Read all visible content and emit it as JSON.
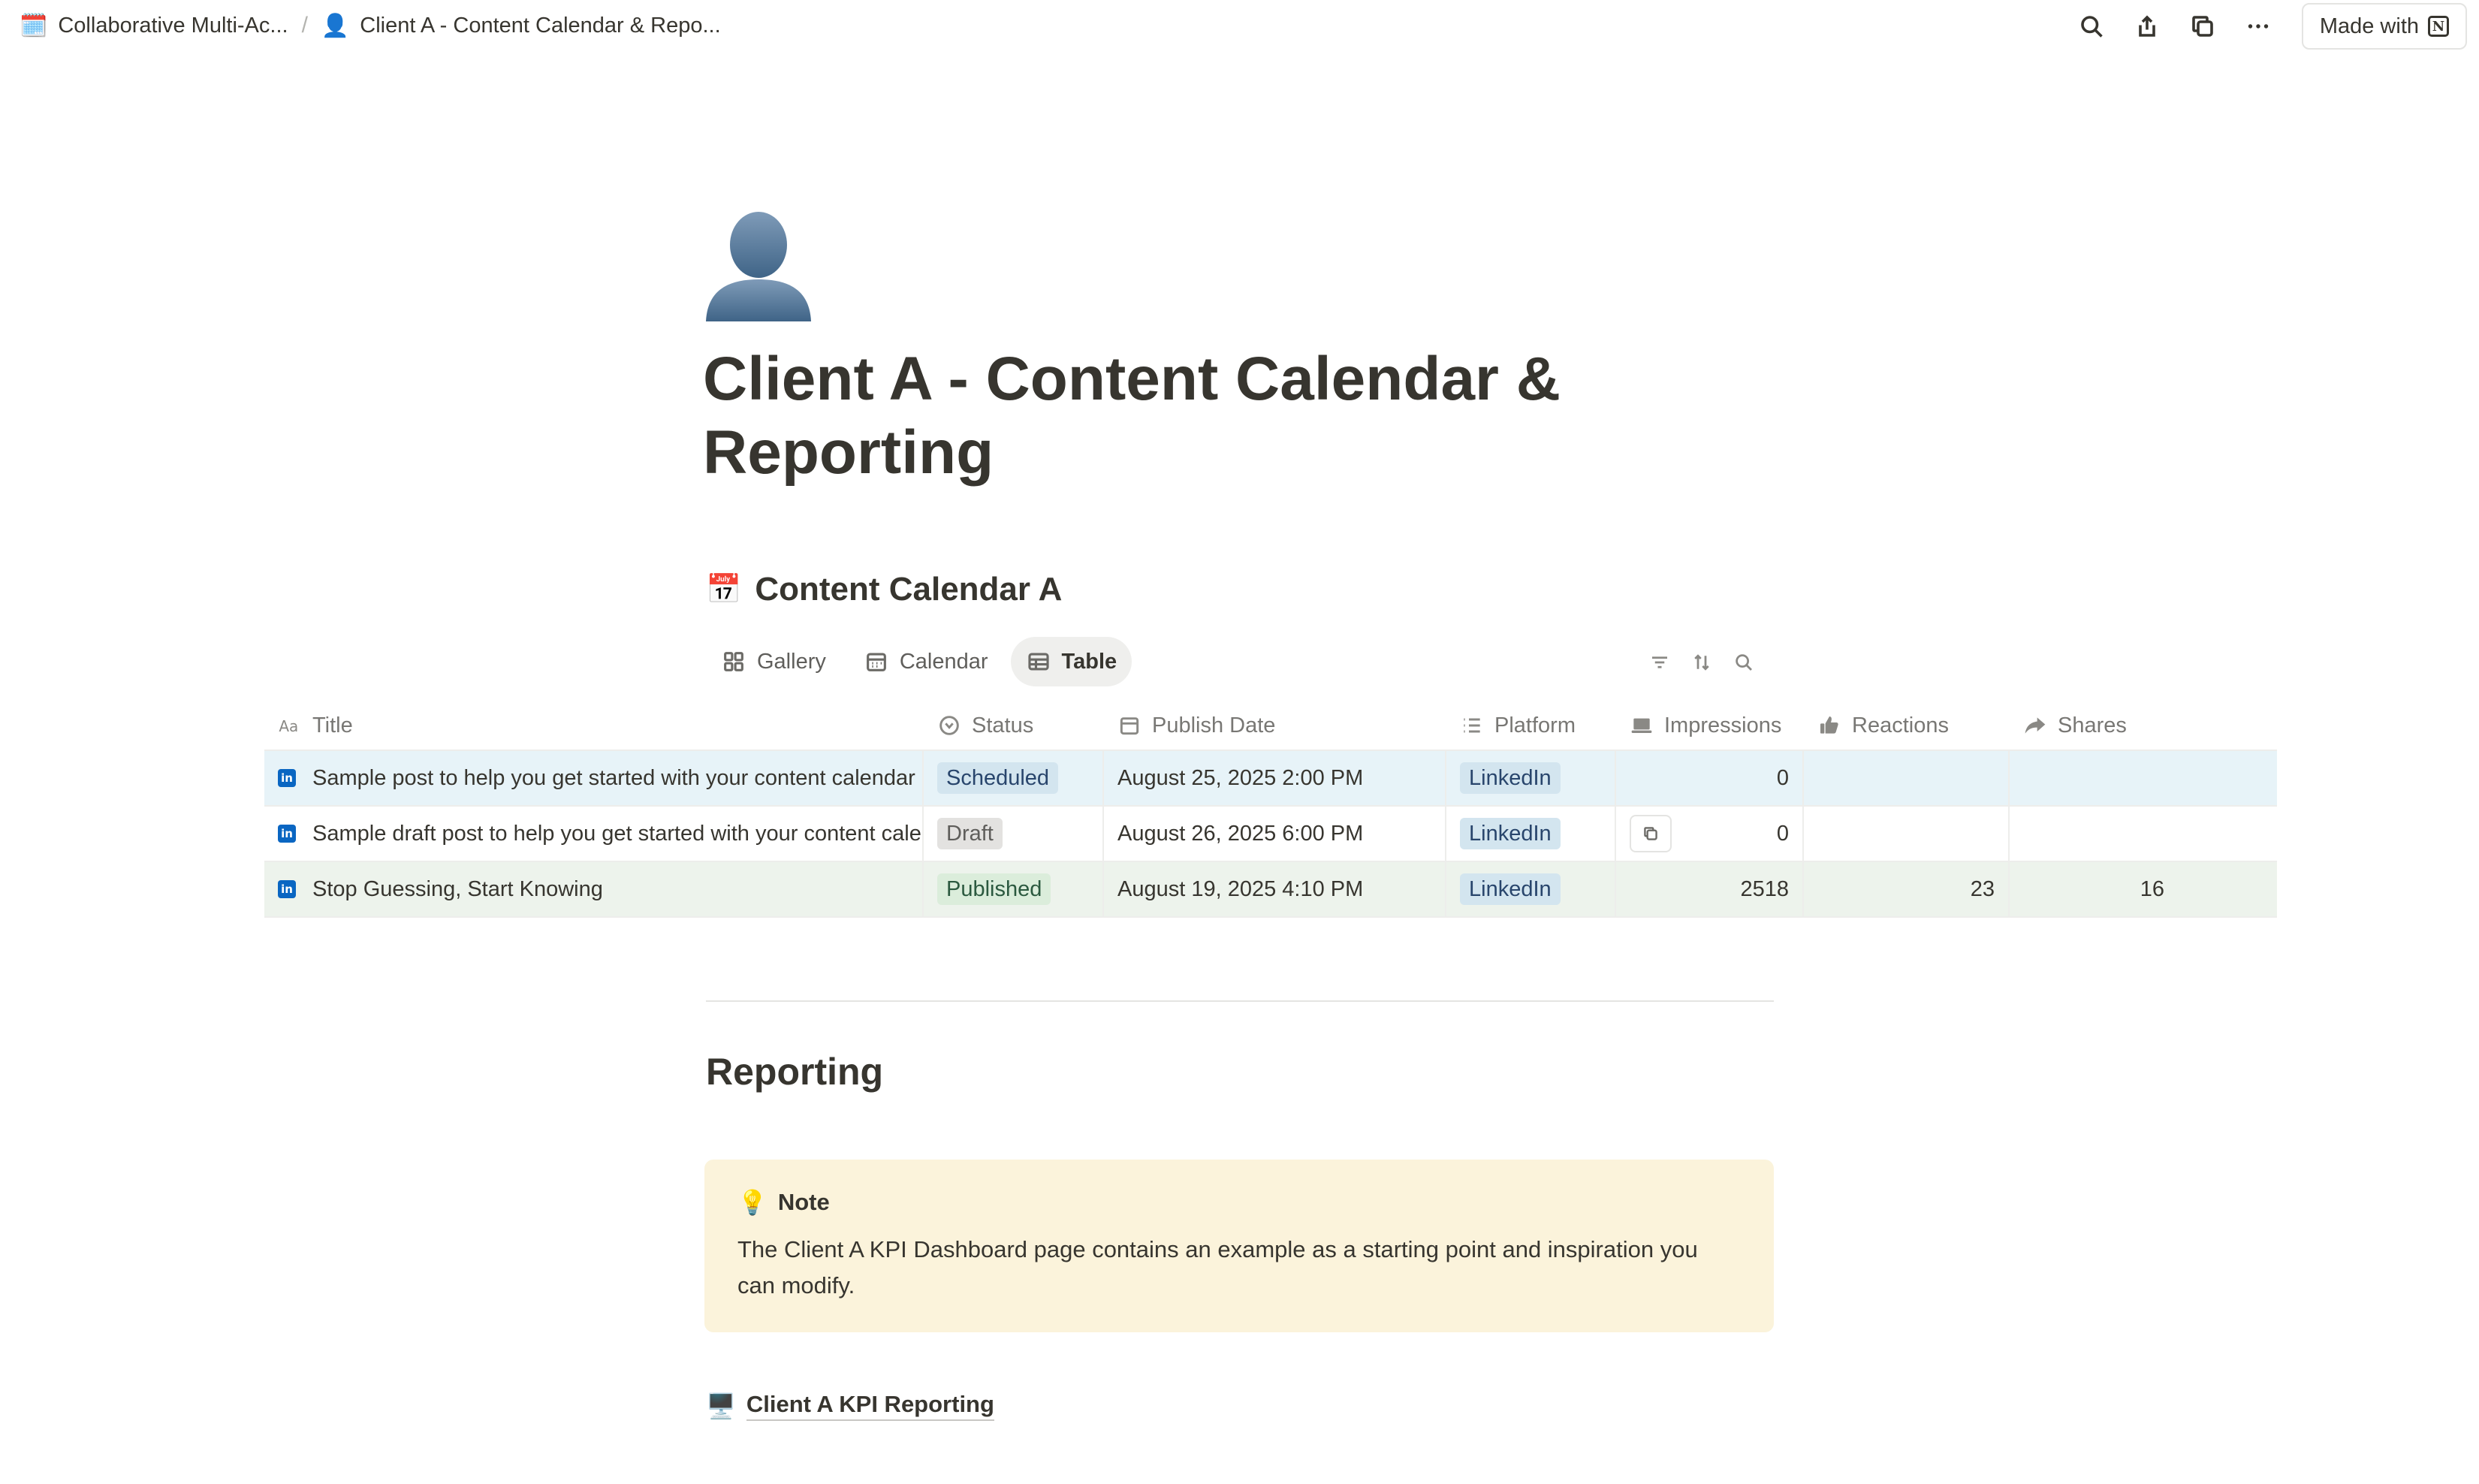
{
  "breadcrumb": [
    {
      "icon": "calendar-emoji",
      "emoji": "🗓️",
      "label": "Collaborative Multi-Ac..."
    },
    {
      "icon": "person-emoji",
      "emoji": "👤",
      "label": "Client A - Content Calendar & Repo..."
    }
  ],
  "breadcrumb_separator": "/",
  "topbar": {
    "icons": [
      "search-icon",
      "share-icon",
      "duplicate-icon",
      "more-icon"
    ],
    "made_with_label": "Made with"
  },
  "page": {
    "icon": "person-silhouette",
    "title": "Client A - Content Calendar & Reporting"
  },
  "database": {
    "emoji": "📅",
    "title": "Content Calendar A",
    "views": [
      {
        "label": "Gallery",
        "icon": "gallery-icon",
        "active": false
      },
      {
        "label": "Calendar",
        "icon": "calendar-icon",
        "active": false
      },
      {
        "label": "Table",
        "icon": "table-icon",
        "active": true
      }
    ],
    "columns": [
      {
        "label": "Title",
        "icon": "text-type-icon"
      },
      {
        "label": "Status",
        "icon": "status-icon"
      },
      {
        "label": "Publish Date",
        "icon": "date-icon"
      },
      {
        "label": "Platform",
        "icon": "list-icon"
      },
      {
        "label": "Impressions",
        "icon": "laptop-icon"
      },
      {
        "label": "Reactions",
        "icon": "thumbs-up-icon"
      },
      {
        "label": "Shares",
        "icon": "share-arrow-icon"
      }
    ],
    "rows": [
      {
        "title": "Sample post to help you get started with your content calendar",
        "status": "Scheduled",
        "publish_date": "August 25, 2025 2:00 PM",
        "platform": "LinkedIn",
        "impressions": "0",
        "reactions": "",
        "shares": ""
      },
      {
        "title": "Sample draft post to help you get started with your content calendar",
        "status": "Draft",
        "publish_date": "August 26, 2025 6:00 PM",
        "platform": "LinkedIn",
        "impressions": "0",
        "reactions": "",
        "shares": ""
      },
      {
        "title": "Stop Guessing, Start Knowing",
        "status": "Published",
        "publish_date": "August 19, 2025 4:10 PM",
        "platform": "LinkedIn",
        "impressions": "2518",
        "reactions": "23",
        "shares": "16"
      }
    ]
  },
  "reporting": {
    "heading": "Reporting",
    "callout": {
      "emoji": "💡",
      "title": "Note",
      "body": "The Client A KPI Dashboard page contains an example as a starting point and inspiration you can modify."
    },
    "link": {
      "emoji": "🖥️",
      "label": "Client A KPI Reporting"
    }
  },
  "colors": {
    "row_scheduled_bg": "#e7f3f8",
    "row_published_bg": "#edf3ec",
    "callout_bg": "#fbf3db",
    "linkedin_blue": "#0a66c2"
  }
}
